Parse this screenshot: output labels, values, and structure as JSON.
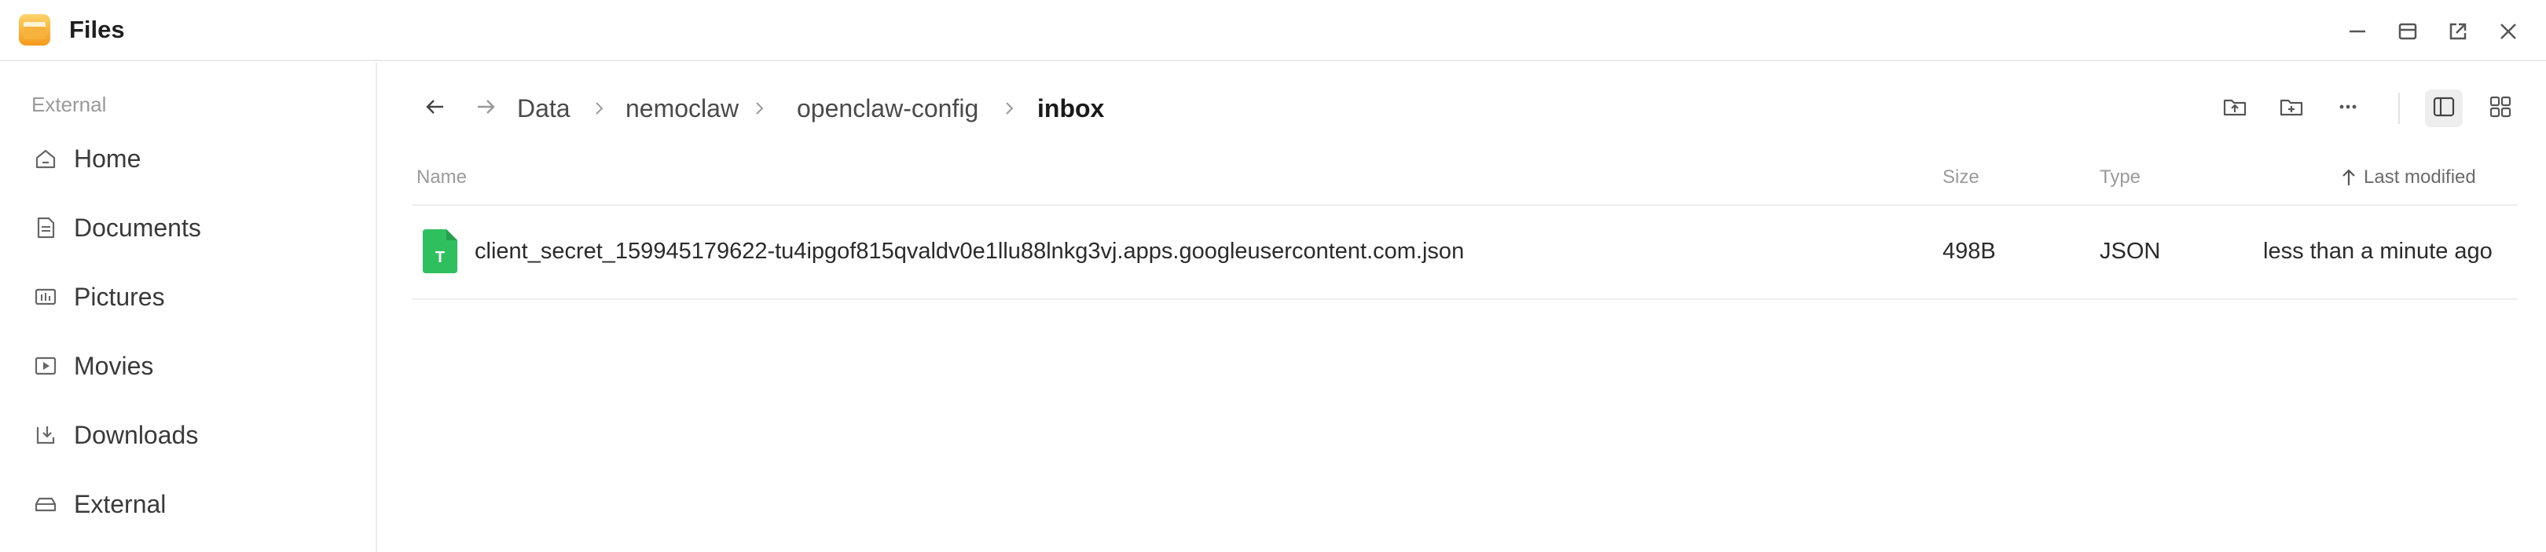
{
  "window": {
    "title": "Files",
    "icon": "folder-app-icon",
    "controls": [
      "minimize-icon",
      "maximize-icon",
      "popout-icon",
      "close-icon"
    ]
  },
  "sidebar": {
    "heading": "External",
    "items": [
      {
        "label": "Home",
        "icon": "home-icon"
      },
      {
        "label": "Documents",
        "icon": "document-icon"
      },
      {
        "label": "Pictures",
        "icon": "pictures-icon"
      },
      {
        "label": "Movies",
        "icon": "movie-icon"
      },
      {
        "label": "Downloads",
        "icon": "download-icon"
      },
      {
        "label": "External",
        "icon": "drive-icon"
      }
    ]
  },
  "breadcrumb": {
    "items": [
      "Data",
      "nemoclaw",
      "openclaw-config"
    ],
    "current": "inbox"
  },
  "table": {
    "columns": {
      "name": "Name",
      "size": "Size",
      "type": "Type",
      "modified": "Last modified"
    },
    "sort": "ascending",
    "rows": [
      {
        "name": "client_secret_159945179622-tu4ipgof815qvaldv0e1llu88lnkg3vj.apps.googleusercontent.com.json",
        "size": "498B",
        "type": "JSON",
        "modified": "less than a minute ago",
        "icon_letter": "T",
        "icon_color": "#2fbf5e"
      }
    ]
  },
  "colors": {
    "accent_file": "#2fbf5e",
    "app_icon": "#f5a623"
  }
}
